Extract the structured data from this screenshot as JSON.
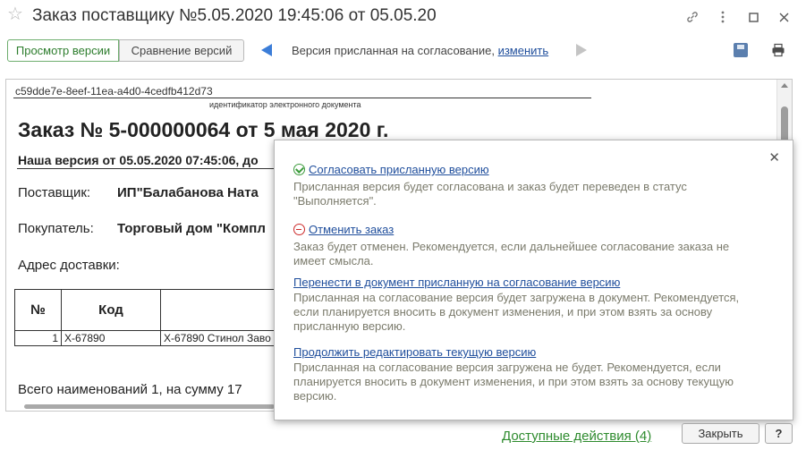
{
  "window": {
    "title": "Заказ поставщику №5.05.2020 19:45:06 от 05.05.20"
  },
  "toolbar": {
    "view_version_label": "Просмотр версии",
    "compare_versions_label": "Сравнение версий",
    "version_status_text": "Версия присланная на согласование,",
    "version_change_link": "изменить"
  },
  "document": {
    "guid": "c59dde7e-8eef-11ea-a4d0-4cedfb412d73",
    "guid_caption": "идентификатор электронного документа",
    "title": "Заказ № 5-000000064 от 5 мая 2020 г.",
    "our_version": "Наша версия от 05.05.2020 07:45:06, до",
    "supplier_label": "Поставщик:",
    "supplier_value": "ИП\"Балабанова Ната",
    "buyer_label": "Покупатель:",
    "buyer_value": "Торговый дом \"Компл",
    "address_label": "Адрес доставки:",
    "table": {
      "headers": [
        "№",
        "Код",
        ""
      ],
      "rows": [
        {
          "no": "1",
          "code": "Х-67890",
          "name": "Х-67890 Стинол Заво"
        }
      ]
    },
    "total": "Всего наименований 1, на сумму 17"
  },
  "popup": {
    "actions": [
      {
        "icon": "check-circle-icon",
        "link": "Согласовать присланную версию",
        "desc": "Присланная версия будет согласована и заказ будет переведен в статус \"Выполняется\"."
      },
      {
        "icon": "cancel-circle-icon",
        "link": "Отменить заказ",
        "desc": "Заказ будет отменен. Рекомендуется, если дальнейшее согласование заказа не имеет смысла."
      },
      {
        "link": "Перенести в документ присланную на согласование версию",
        "desc": "Присланная на согласование версия будет загружена в документ. Рекомендуется, если планируется вносить в документ изменения, и при этом взять за основу присланную версию."
      },
      {
        "link": "Продолжить редактировать текущую версию",
        "desc": "Присланная на согласование версия загружена не будет. Рекомендуется, если планируется вносить в документ изменения, и при этом взять за основу текущую версию."
      }
    ]
  },
  "footer": {
    "available_actions": "Доступные действия (4)",
    "close_label": "Закрыть",
    "help_label": "?"
  },
  "colors": {
    "link_blue": "#1f4e9c",
    "accent_green": "#2e8b2e",
    "desc_gray": "#7b7b6c"
  }
}
